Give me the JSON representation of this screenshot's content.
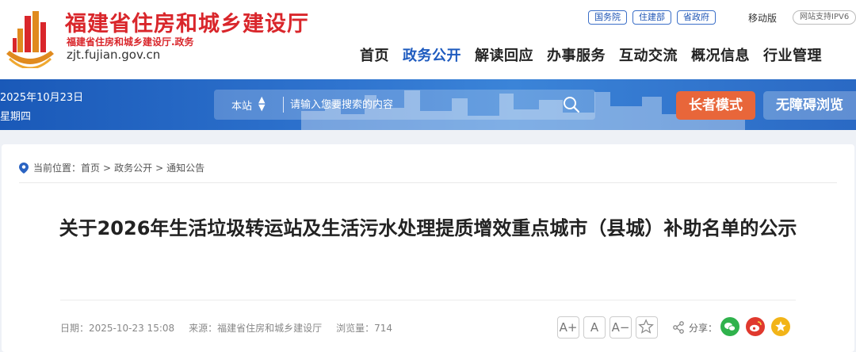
{
  "header": {
    "site_title": "福建省住房和城乡建设厅",
    "site_subtitle": "福建省住房和城乡建设厅.政务",
    "domain": "zjt.fujian.gov.cn",
    "top_links": [
      "国务院",
      "住建部",
      "省政府"
    ],
    "mobile_label": "移动版",
    "ipv6_label": "网站支持IPV6",
    "brand_color": "#d9262b",
    "link_color": "#1e55b5"
  },
  "nav": {
    "items": [
      "首页",
      "政务公开",
      "解读回应",
      "办事服务",
      "互动交流",
      "概况信息",
      "行业管理"
    ],
    "active": "政务公开"
  },
  "banner": {
    "date": "2025年10月23日",
    "weekday": "星期四",
    "search_scope": "本站",
    "search_placeholder": "请输入您要搜索的内容",
    "elder_mode_label": "长者模式",
    "accessibility_label": "无障碍浏览",
    "banner_color": "#2a69c4",
    "elder_button_color": "#e8663a"
  },
  "breadcrumb": {
    "prefix": "当前位置：",
    "items": [
      "首页",
      "政务公开",
      "通知公告"
    ],
    "separator": ">"
  },
  "article": {
    "title": "关于2026年生活垃圾转运站及生活污水处理提质增效重点城市（县城）补助名单的公示",
    "date_label": "日期：2025-10-23 15:08",
    "source_label": "来源：福建省住房和城乡建设厅",
    "views_label": "浏览量：714"
  },
  "tools": {
    "font_larger": "A+",
    "font_normal": "A",
    "font_smaller": "A−",
    "share_label": "分享：",
    "icons": [
      "star-icon",
      "share-icon",
      "wechat-icon",
      "weibo-icon",
      "qzone-icon"
    ]
  }
}
